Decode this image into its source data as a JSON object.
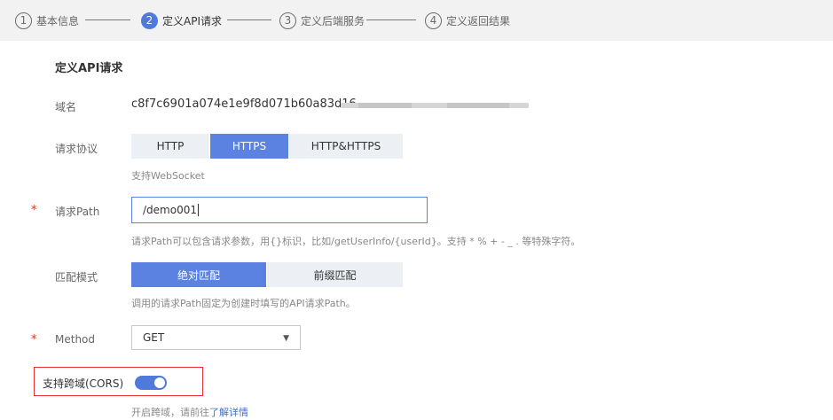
{
  "steps": [
    {
      "num": "1",
      "label": "基本信息"
    },
    {
      "num": "2",
      "label": "定义API请求"
    },
    {
      "num": "3",
      "label": "定义后端服务"
    },
    {
      "num": "4",
      "label": "定义返回结果"
    }
  ],
  "section_title": "定义API请求",
  "domain": {
    "label": "域名",
    "value": "c8f7c6901a074e1e9f8d071b60a83d16"
  },
  "protocol": {
    "label": "请求协议",
    "options": [
      "HTTP",
      "HTTPS",
      "HTTP&HTTPS"
    ],
    "selected": "HTTPS",
    "hint": "支持WebSocket"
  },
  "path": {
    "required_mark": "*",
    "label": "请求Path",
    "value": "/demo001",
    "hint": "请求Path可以包含请求参数，用{}标识，比如/getUserInfo/{userId}。支持 * % + - _ . 等特殊字符。"
  },
  "match_mode": {
    "label": "匹配模式",
    "options": [
      "绝对匹配",
      "前缀匹配"
    ],
    "selected": "绝对匹配",
    "hint": "调用的请求Path固定为创建时填写的API请求Path。"
  },
  "method": {
    "required_mark": "*",
    "label": "Method",
    "value": "GET"
  },
  "cors": {
    "label": "支持跨域(CORS)",
    "enabled": true,
    "hint_prefix": "开启跨域，请前往",
    "hint_link": "了解详情"
  },
  "colors": {
    "accent": "#4f79db",
    "required": "#e0301e",
    "highlight_box": "#e03030"
  }
}
